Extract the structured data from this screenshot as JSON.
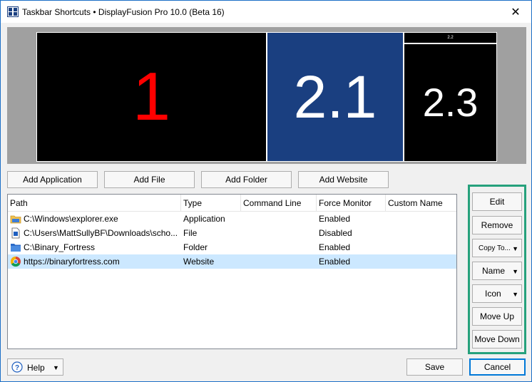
{
  "window": {
    "title": "Taskbar Shortcuts • DisplayFusion Pro 10.0 (Beta 16)",
    "close_glyph": "✕",
    "icon": "displayfusion-app-icon"
  },
  "monitors": [
    {
      "label": "1",
      "color": "#ff0000"
    },
    {
      "label": "2.1",
      "color": "#ffffff",
      "background": "#1a3f80"
    },
    {
      "label": "2.2",
      "color": "#ffffff"
    },
    {
      "label": "2.3",
      "color": "#ffffff"
    }
  ],
  "add_buttons": {
    "application": "Add Application",
    "file": "Add File",
    "folder": "Add Folder",
    "website": "Add Website"
  },
  "table": {
    "columns": [
      "Path",
      "Type",
      "Command Line",
      "Force Monitor",
      "Custom Name"
    ],
    "rows": [
      {
        "icon": "explorer-folder-icon",
        "path": "C:\\Windows\\explorer.exe",
        "type": "Application",
        "command_line": "",
        "force_monitor": "Enabled",
        "custom_name": ""
      },
      {
        "icon": "file-icon",
        "path": "C:\\Users\\MattSullyBF\\Downloads\\scho...",
        "type": "File",
        "command_line": "",
        "force_monitor": "Disabled",
        "custom_name": ""
      },
      {
        "icon": "folder-icon",
        "path": "C:\\Binary_Fortress",
        "type": "Folder",
        "command_line": "",
        "force_monitor": "Enabled",
        "custom_name": ""
      },
      {
        "icon": "chrome-icon",
        "path": "https://binaryfortress.com",
        "type": "Website",
        "command_line": "",
        "force_monitor": "Enabled",
        "custom_name": "",
        "selected": true
      }
    ]
  },
  "side_buttons": {
    "edit": "Edit",
    "remove": "Remove",
    "copy_to": "Copy To...",
    "name": "Name",
    "icon": "Icon",
    "move_up": "Move Up",
    "move_down": "Move Down"
  },
  "footer": {
    "help": "Help",
    "save": "Save",
    "cancel": "Cancel"
  },
  "colors": {
    "highlight_border": "#26a17c",
    "selected_row": "#cce8ff"
  }
}
